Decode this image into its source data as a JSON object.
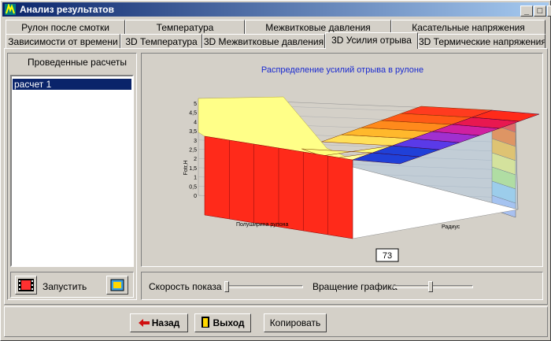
{
  "window": {
    "title": "Анализ результатов"
  },
  "title_buttons": {
    "minimize": "_",
    "maximize": "□",
    "close": "×"
  },
  "tabs_row1": [
    "Рулон после смотки",
    "Температура",
    "Межвитковые давления",
    "Касательные напряжения"
  ],
  "tabs_row2": [
    "Зависимости от времени",
    "3D Температура",
    "3D Межвитковые давления",
    "3D Усилия отрыва",
    "3D Термические напряжения"
  ],
  "left_panel": {
    "header": "Проведенные расчеты",
    "items": [
      "расчет 1"
    ],
    "run_label": "Запустить"
  },
  "chart_data": {
    "type": "surface",
    "title": "Распределение усилий отрыва в рулоне",
    "xlabel": "Полуширина рулона",
    "ylabel": "Радиус",
    "zlabel": "Fotr,Н",
    "zticks": [
      "0",
      "0,5",
      "1",
      "1,5",
      "2",
      "2,5",
      "3",
      "3,5",
      "4",
      "4,5",
      "5"
    ],
    "zlim": [
      0,
      5
    ],
    "grid": true
  },
  "chart_value_box": "73",
  "controls": {
    "speed_label": "Скорость показа",
    "rotation_label": "Вращение графика",
    "speed_value": 0,
    "rotation_value": 0.47
  },
  "buttons": {
    "back": "Назад",
    "exit": "Выход",
    "copy": "Копировать"
  },
  "colors": {
    "title_bar": "#0a246a",
    "surface_side": "#ff2a1a",
    "chart_title": "#1a2ad0"
  }
}
